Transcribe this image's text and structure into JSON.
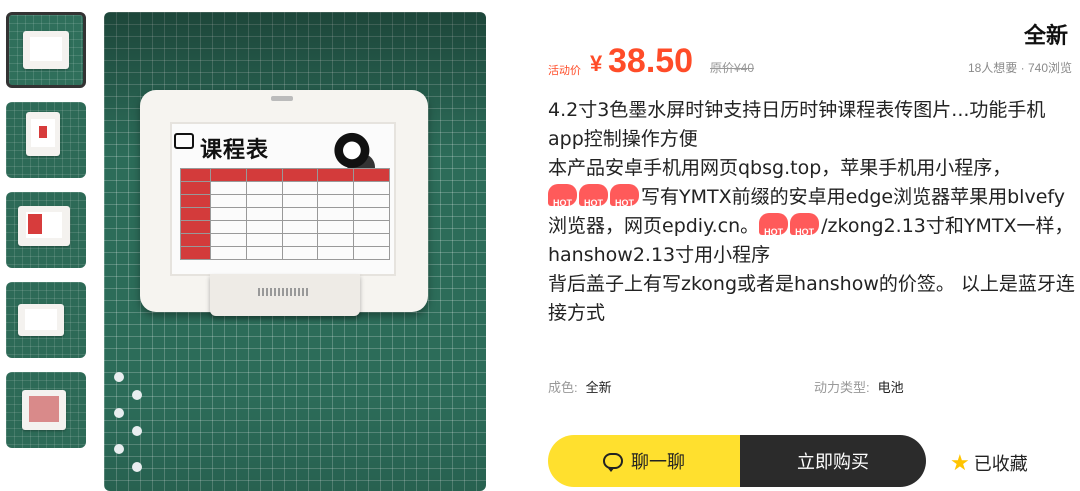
{
  "gallery": {
    "thumbs": [
      "thumb-1",
      "thumb-2",
      "thumb-3",
      "thumb-4",
      "thumb-5"
    ],
    "screen_title": "课程表"
  },
  "badge": {
    "condition": "全新"
  },
  "price": {
    "activity_label": "活动价",
    "currency": "¥",
    "value": "38.50",
    "original": "原价¥40"
  },
  "stats": {
    "views": "18人想要 · 740浏览"
  },
  "description": {
    "line1": "4.2寸3色墨水屏时钟支持日历时钟课程表传图片...功能手机app控制操作方便",
    "line2": "本产品安卓手机用网页qbsg.top，苹果手机用小程序，",
    "hot_label": "HOT",
    "line3": "写有YMTX前缀的安卓用edge浏览器苹果用blvefy浏览器，网页epdiy.cn。",
    "line4": "/zkong2.13寸和YMTX一样，hanshow2.13寸用小程序",
    "line5": "背后盖子上有写zkong或者是hanshow的价签。 以上是蓝牙连接方式"
  },
  "attributes": [
    {
      "key": "成色:",
      "value": "全新"
    },
    {
      "key": "动力类型:",
      "value": "电池"
    }
  ],
  "actions": {
    "chat": "聊一聊",
    "buy": "立即购买",
    "favorite": "已收藏"
  },
  "colors": {
    "accent_yellow": "#ffe02e",
    "price_red": "#ff4c28",
    "dark": "#2b2b2b"
  }
}
